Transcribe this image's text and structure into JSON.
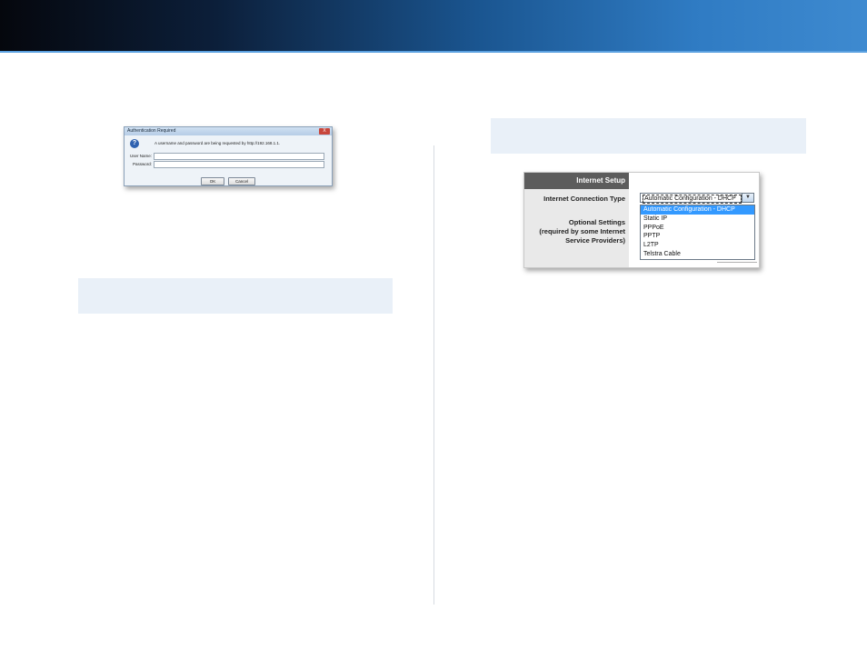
{
  "auth_dialog": {
    "title": "Authentication Required",
    "close_label": "X",
    "message": "A username and password are being requested by http://192.168.1.1.",
    "username_label": "User Name:",
    "password_label": "Password:",
    "ok_label": "OK",
    "cancel_label": "Cancel"
  },
  "internet_setup": {
    "header": "Internet Setup",
    "connection_type_label": "Internet Connection Type",
    "optional_settings_line1": "Optional Settings",
    "optional_settings_line2": "(required by some Internet",
    "optional_settings_line3": "Service Providers)",
    "selected_value": "Automatic Configuration - DHCP",
    "options": [
      "Automatic Configuration - DHCP",
      "Static IP",
      "PPPoE",
      "PPTP",
      "L2TP",
      "Telstra Cable"
    ]
  },
  "colors": {
    "note_box": "#e9f0f8",
    "selected_option": "#3399ff"
  }
}
